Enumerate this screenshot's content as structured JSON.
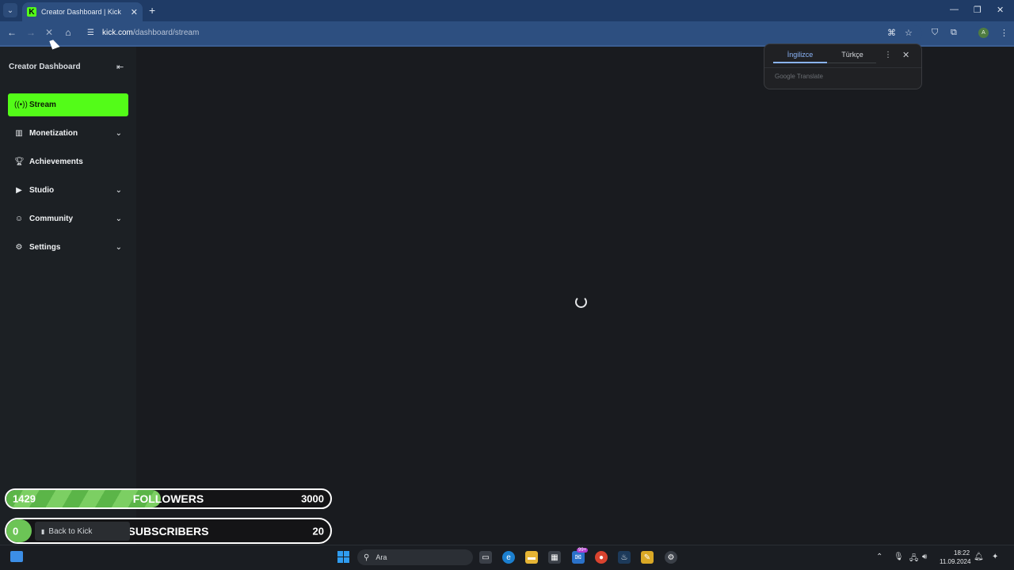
{
  "browser": {
    "tab_title": "Creator Dashboard | Kick",
    "tab_favicon": "K",
    "new_tab_label": "+",
    "url_host": "kick.com",
    "url_path": "/dashboard/stream",
    "profile_initial": "A",
    "accent": "#2d4f80"
  },
  "sidebar": {
    "title": "Creator Dashboard",
    "items": [
      {
        "label": "Stream",
        "icon": "broadcast-icon",
        "active": true
      },
      {
        "label": "Monetization",
        "icon": "chart-icon",
        "expandable": true
      },
      {
        "label": "Achievements",
        "icon": "trophy-icon"
      },
      {
        "label": "Studio",
        "icon": "studio-icon",
        "expandable": true
      },
      {
        "label": "Community",
        "icon": "community-icon",
        "expandable": true
      },
      {
        "label": "Settings",
        "icon": "gear-icon",
        "expandable": true
      }
    ],
    "active_color": "#53fc18"
  },
  "translate_popup": {
    "tab_source": "İngilizce",
    "tab_target": "Türkçe",
    "brand": "Google Translate"
  },
  "overlay": {
    "followers": {
      "current": "1429",
      "label": "FOLLOWERS",
      "target": "3000",
      "progress": 0.476
    },
    "subscribers": {
      "current": "0",
      "label": "SUBSCRIBERS",
      "target": "20",
      "progress": 0.0
    },
    "back_to_kick": "Back to Kick",
    "fill_color": "#6cc456"
  },
  "taskbar": {
    "search_placeholder": "Ara",
    "mail_badge": "99+",
    "time": "18:22",
    "date": "11.09.2024"
  }
}
